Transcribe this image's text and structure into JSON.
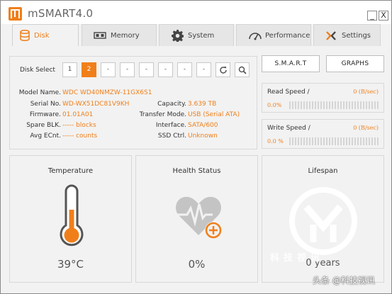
{
  "app": {
    "title": "mSMART4.0"
  },
  "window": {
    "minimize": "_",
    "close": "X"
  },
  "tabs": [
    {
      "label": "Disk",
      "icon": "database-icon",
      "active": true
    },
    {
      "label": "Memory",
      "icon": "memory-chip-icon"
    },
    {
      "label": "System",
      "icon": "gear-icon"
    },
    {
      "label": "Performance",
      "icon": "speedometer-icon"
    },
    {
      "label": "Settings",
      "icon": "tools-icon"
    }
  ],
  "disk_select": {
    "label": "Disk Select",
    "buttons": [
      "1",
      "2",
      "-",
      "-",
      "-",
      "-",
      "-",
      "-"
    ],
    "selected": "2"
  },
  "info": {
    "model_name": {
      "label": "Model Name.",
      "value": "WDC WD40NMZW-11GX6S1"
    },
    "serial_no": {
      "label": "Serial No.",
      "value": "WD-WX51DC81V9KH"
    },
    "firmware": {
      "label": "Firmware.",
      "value": "01.01A01"
    },
    "spare_blk": {
      "label": "Spare BLK.",
      "value": "----- blocks"
    },
    "avg_ecnt": {
      "label": "Avg ECnt.",
      "value": "----- counts"
    },
    "capacity": {
      "label": "Capacity.",
      "value": "3.639 TB"
    },
    "transfer_mode": {
      "label": "Transfer Mode.",
      "value": "USB (Serial ATA)"
    },
    "interface": {
      "label": "Interface.",
      "value": "SATA/600"
    },
    "ssd_ctrl": {
      "label": "SSD Ctrl.",
      "value": "Unknown"
    }
  },
  "buttons": {
    "smart": "S.M.A.R.T",
    "graphs": "GRAPHS"
  },
  "read_speed": {
    "label": "Read Speed /",
    "value": "0 (B/sec)",
    "percent": "0.0%",
    "fill": 0
  },
  "write_speed": {
    "label": "Write Speed /",
    "value": "0 (B/sec)",
    "percent": "0.0 %",
    "fill": 0
  },
  "panels": {
    "temperature": {
      "title": "Temperature",
      "value": "39°C",
      "level": 0.45
    },
    "health": {
      "title": "Health Status",
      "value": "0%"
    },
    "lifespan": {
      "title": "Lifespan",
      "value": "0 years"
    }
  },
  "watermark": {
    "text": "科技视讯",
    "credit": "头条 @科技视讯"
  },
  "colors": {
    "accent": "#f07f1a",
    "panel_bg": "#f2f2f2",
    "icon_gray": "#bdbdbd"
  }
}
